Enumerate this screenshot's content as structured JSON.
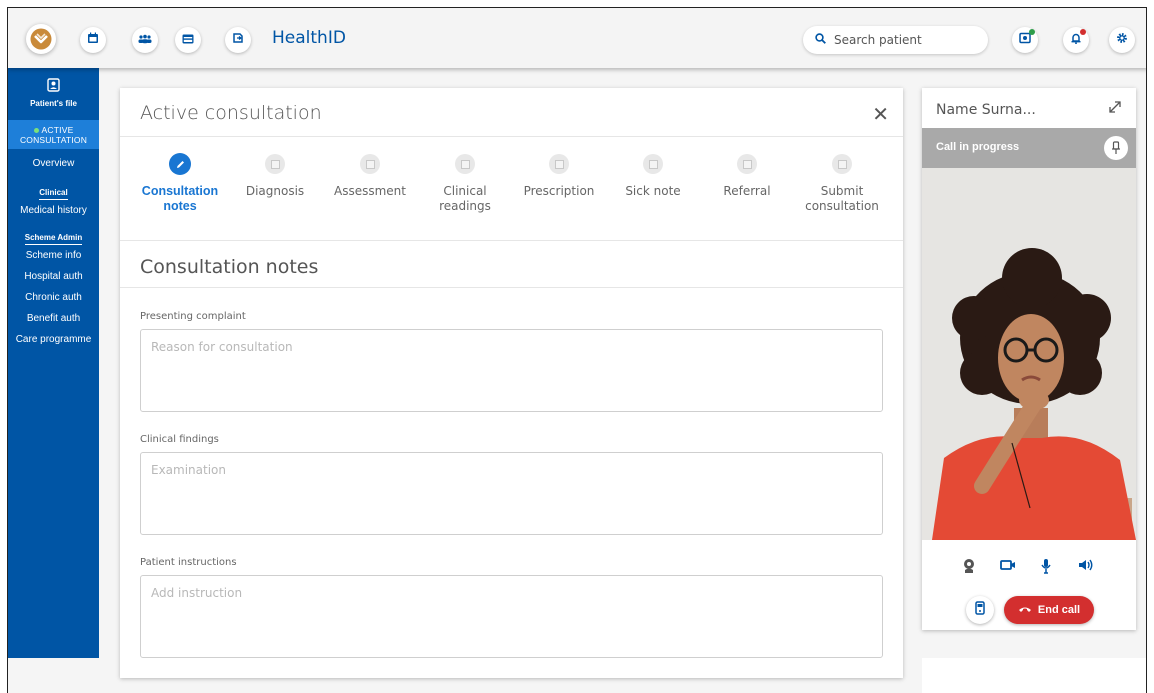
{
  "topbar": {
    "app_title": "HealthID",
    "search_placeholder": "Search patient",
    "colors": {
      "brand": "#0055a5",
      "logo": "#c98a3a",
      "green_dot": "#2e9d4a",
      "red_dot": "#d32f2f"
    }
  },
  "sidebar": {
    "patient_file": "Patient's file",
    "active_line1": "ACTIVE",
    "active_line2": "CONSULTATION",
    "overview": "Overview",
    "clinical_heading": "Clinical",
    "medical_history": "Medical history",
    "scheme_heading": "Scheme Admin",
    "items": [
      "Scheme info",
      "Hospital auth",
      "Chronic auth",
      "Benefit auth",
      "Care programme"
    ]
  },
  "consultation": {
    "title": "Active consultation",
    "close_icon": "close-icon",
    "steps": [
      {
        "line1": "Consultation",
        "line2": "notes",
        "active": true
      },
      {
        "line1": "Diagnosis",
        "line2": ""
      },
      {
        "line1": "Assessment",
        "line2": ""
      },
      {
        "line1": "Clinical",
        "line2": "readings"
      },
      {
        "line1": "Prescription",
        "line2": ""
      },
      {
        "line1": "Sick note",
        "line2": ""
      },
      {
        "line1": "Referral",
        "line2": ""
      },
      {
        "line1": "Submit",
        "line2": "consultation"
      }
    ],
    "section_title": "Consultation notes",
    "fields": [
      {
        "label": "Presenting complaint",
        "placeholder": "Reason for consultation",
        "value": ""
      },
      {
        "label": "Clinical findings",
        "placeholder": "Examination",
        "value": ""
      },
      {
        "label": "Patient instructions",
        "placeholder": "Add instruction",
        "value": ""
      }
    ]
  },
  "video": {
    "name": "Name Surna...",
    "status": "Call in progress",
    "end_call": "End call"
  }
}
